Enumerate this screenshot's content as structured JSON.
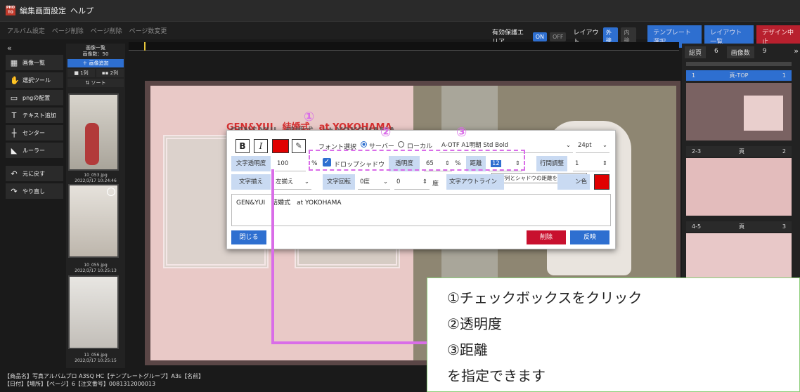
{
  "menubar": {
    "logo_text": "PHOTO PRO",
    "items": [
      "編集画面設定",
      "ヘルプ"
    ]
  },
  "toolbar": {
    "left_items": [
      "アルバム設定",
      "ページ削除",
      "ページ削除",
      "ページ数変更"
    ],
    "protected_area_label": "有効保護エリア",
    "on_label": "ON",
    "off_label": "OFF",
    "layout_label": "レイアウト",
    "outer_label": "外接",
    "inner_label": "内接",
    "template_select": "テンプレート選択",
    "layout_list": "レイアウト一覧",
    "design_stop": "デザイン中止"
  },
  "left_tools": {
    "collapse": "«",
    "items": [
      {
        "label": "画像一覧",
        "icon": "grid-icon"
      },
      {
        "label": "選択ツール",
        "icon": "hand-icon"
      },
      {
        "label": "pngの配置",
        "icon": "image-icon"
      },
      {
        "label": "テキスト追加",
        "icon": "text-icon"
      },
      {
        "label": "センター",
        "icon": "center-icon"
      },
      {
        "label": "ルーラー",
        "icon": "ruler-icon"
      },
      {
        "label": "元に戻す",
        "icon": "undo-icon"
      },
      {
        "label": "やり直し",
        "icon": "redo-icon"
      }
    ]
  },
  "image_panel": {
    "title": "画像一覧",
    "count": "画像数：50",
    "add_button": "＋ 画像追加",
    "col1": "■ 1列",
    "col2": "▪▪ 2列",
    "sort": "⇅ ソート",
    "thumbs": [
      {
        "name": "10_053.jpg",
        "date": "2022/3/17 10:24:46"
      },
      {
        "name": "10_055.jpg",
        "date": "2022/3/17 10:25:13"
      },
      {
        "name": "11_056.jpg",
        "date": "2022/3/17 10:25:15"
      }
    ]
  },
  "right_panel": {
    "total_pages_label": "総頁",
    "total_pages": "6",
    "image_count_label": "画像数",
    "image_count": "9",
    "pages": [
      {
        "range": "1",
        "name": "頁-TOP",
        "num": "1"
      },
      {
        "range": "2-3",
        "name": "頁",
        "num": "2"
      },
      {
        "range": "4-5",
        "name": "頁",
        "num": "3"
      }
    ]
  },
  "canvas": {
    "title_text": "GEN&YUI　結婚式　at YOKOHAMA",
    "shadow_text": "GEN&YUI　結婚式　at YOKOHAMA"
  },
  "dialog": {
    "bold": "B",
    "italic": "I",
    "font_select_label": "フォント選択",
    "server_label": "サーバー",
    "local_label": "ローカル",
    "font_name": "A-OTF A1明朝 Std Bold",
    "font_size": "24pt",
    "text_opacity_label": "文字透明度",
    "text_opacity_value": "100",
    "percent": "%",
    "drop_shadow_label": "ドロップシャドウ",
    "opacity_label": "透明度",
    "opacity_value": "65",
    "distance_label": "距離",
    "distance_value": "12",
    "line_spacing_label": "行間調整",
    "line_spacing_value": "1",
    "tooltip": "文字列とシャドウの距離を設定します",
    "align_label": "文字揃え",
    "align_value": "左揃え",
    "rotation_label": "文字回転",
    "rotation_value": "0度",
    "rotation_num": "0",
    "degree": "度",
    "outline_label": "文字アウトライン",
    "outline_color_label": "ン色",
    "text_content": "GEN&YUI　結婚式　at YOKOHAMA",
    "close_button": "閉じる",
    "delete_button": "削除",
    "apply_button": "反映"
  },
  "annotations": {
    "n1": "①",
    "n2": "②",
    "n3": "③"
  },
  "callout": {
    "lines": [
      "①チェックボックスをクリック",
      "②透明度",
      "③距離",
      "を指定できます"
    ]
  },
  "status": {
    "line1": "【商品名】写真アルバムプロ A3SQ HC【テンプレートグループ】A3s【名前】",
    "line2": "【日付】【場所】【ページ】6【注文番号】0081312000013"
  }
}
